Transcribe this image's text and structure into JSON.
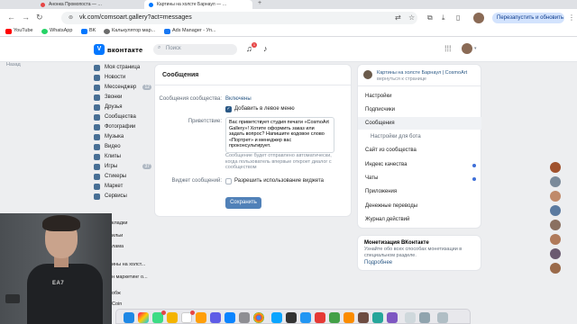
{
  "browser": {
    "tabs": [
      {
        "title": "Анонка Промопоста — …",
        "favicon_color": "#e64646"
      },
      {
        "title": "Картины на холсте Барнаул — …",
        "favicon_color": "#0077ff"
      }
    ],
    "new_tab_glyph": "+",
    "url": "vk.com/comsoart.gallery?act=messages",
    "restart_label": "Перезапустить и обновить",
    "bookmarks": [
      {
        "label": "YouTube",
        "color": "#ff0000"
      },
      {
        "label": "WhatsApp",
        "color": "#25d366"
      },
      {
        "label": "BK",
        "color": "#0077ff"
      },
      {
        "label": "Калькулятор мар...",
        "color": "#6b6b6b"
      },
      {
        "label": "Ads Manager - Уп...",
        "color": "#1877f2"
      }
    ]
  },
  "vk": {
    "logo_glyph": "V",
    "brand": "вконтакте",
    "search_placeholder": "Поиск",
    "notif_count": "1",
    "back_label": "Назад"
  },
  "nav": [
    {
      "label": "Моя страница",
      "count": ""
    },
    {
      "label": "Новости",
      "count": ""
    },
    {
      "label": "Мессенджер",
      "count": "12"
    },
    {
      "label": "Звонки",
      "count": ""
    },
    {
      "label": "Друзья",
      "count": ""
    },
    {
      "label": "Сообщества",
      "count": ""
    },
    {
      "label": "Фотографии",
      "count": ""
    },
    {
      "label": "Музыка",
      "count": ""
    },
    {
      "label": "Видео",
      "count": ""
    },
    {
      "label": "Клипы",
      "count": ""
    },
    {
      "label": "Игры",
      "count": "37"
    },
    {
      "label": "Стикеры",
      "count": ""
    },
    {
      "label": "Маркет",
      "count": ""
    },
    {
      "label": "Сервисы",
      "count": ""
    }
  ],
  "nav_partial": [
    "кладки",
    "ильи",
    "лама",
    "ины на холст...",
    "н маркетинг о...",
    "обж",
    "Coin"
  ],
  "settings": {
    "title": "Сообщения",
    "status_label": "Сообщения сообщества:",
    "status_value": "Включены",
    "add_left_menu": "Добавить в левое меню",
    "greeting_label": "Приветствие:",
    "greeting_text": "Вас приветствует студия печати «CosmoArt Gallery»! Хотите оформить заказ или задать вопрос? Напишите кодовое слово «Портрет» и менеджер вас проконсультирует.",
    "greeting_note": "Сообщение будет отправлено автоматически, когда пользователь впервые откроет диалог с сообществом",
    "widget_label": "Виджет сообщений:",
    "widget_checkbox": "Разрешить использование виджета",
    "save_label": "Сохранить"
  },
  "right_menu": {
    "group_name": "Картины на холсте Барнаул | CosmoArt",
    "group_back": "вернуться к странице",
    "items": [
      {
        "label": "Настройки",
        "active": false,
        "sub": false,
        "dot": false
      },
      {
        "label": "Подписчики",
        "active": false,
        "sub": false,
        "dot": false
      },
      {
        "label": "Сообщения",
        "active": true,
        "sub": false,
        "dot": false
      },
      {
        "label": "Настройки для бота",
        "active": false,
        "sub": true,
        "dot": false
      },
      {
        "label": "Сайт из сообщества",
        "active": false,
        "sub": false,
        "dot": false
      },
      {
        "label": "Индекс качества",
        "active": false,
        "sub": false,
        "dot": true
      },
      {
        "label": "Чаты",
        "active": false,
        "sub": false,
        "dot": true
      },
      {
        "label": "Приложения",
        "active": false,
        "sub": false,
        "dot": false
      },
      {
        "label": "Денежные переводы",
        "active": false,
        "sub": false,
        "dot": false
      },
      {
        "label": "Журнал действий",
        "active": false,
        "sub": false,
        "dot": false
      }
    ]
  },
  "monetization": {
    "title": "Монетизация ВКонтакте",
    "text": "Узнайте обо всех способах монетизации в специальном разделе.",
    "link": "Подробнее"
  },
  "webcam": {
    "shirt_logo": "EA7"
  },
  "colors": {
    "vk_blue": "#0077ff",
    "link": "#2a5885",
    "button": "#5181b8",
    "badge_red": "#e64646"
  }
}
